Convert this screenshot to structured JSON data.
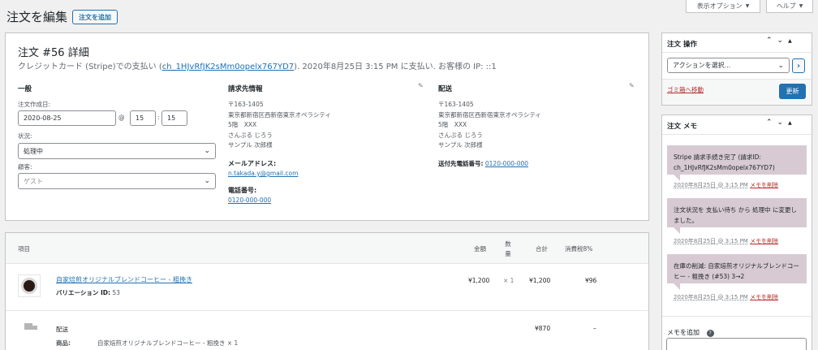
{
  "page": {
    "title": "注文を編集",
    "add_order_button": "注文を追加",
    "screen_options_label": "表示オプション",
    "help_label": "ヘルプ"
  },
  "order": {
    "heading": "注文 #56 詳細",
    "payment_prefix": "クレジットカード (Stripe)での支払い (",
    "payment_link": "ch_1HJvRfJK2sMm0opelx767YD7",
    "payment_suffix": "). 2020年8月25日 3:15 PM に支払い. お客様の IP: ::1"
  },
  "general": {
    "heading": "一般",
    "date_label": "注文作成日:",
    "date_value": "2020-08-25",
    "at_symbol": "@",
    "hour_value": "15",
    "colon": ":",
    "minute_value": "15",
    "status_label": "状況:",
    "status_value": "処理中",
    "customer_label": "顧客:",
    "customer_value": "ゲスト"
  },
  "billing": {
    "heading": "請求先情報",
    "address": "〒163-1405\n東京都新宿区西新宿東京オペラシティ\n5階　XXX\nさんぷる じろう\nサンプル 次郎様",
    "email_label": "メールアドレス:",
    "email_value": "n.takada.y@gmail.com",
    "phone_label": "電話番号:",
    "phone_value": "0120-000-000"
  },
  "shipping": {
    "heading": "配送",
    "address": "〒163-1405\n東京都新宿区西新宿東京オペラシティ\n5階　XXX\nさんぷる じろう\nサンプル 次郎様",
    "phone_label": "送付先電話番号:",
    "phone_value": "0120-000-000"
  },
  "items": {
    "columns": {
      "item": "項目",
      "price": "金額",
      "qty": "数量",
      "total": "合計",
      "tax": "消費税8%"
    },
    "rows": [
      {
        "name": "自家焙煎オリジナルブレンドコーヒー - 粗挽き",
        "variation_label": "バリエーション ID:",
        "variation_id": "53",
        "price": "¥1,200",
        "qty": "× 1",
        "total": "¥1,200",
        "tax": "¥96"
      }
    ],
    "shipping": {
      "label": "配送",
      "products_label": "商品:",
      "products_value": "自家焙煎オリジナルブレンドコーヒー - 粗挽き × 1",
      "total": "¥870",
      "tax": "–"
    }
  },
  "order_actions": {
    "title": "注文 操作",
    "select_placeholder": "アクションを選択...",
    "go_button": "›",
    "trash_link": "ゴミ箱へ移動",
    "update_button": "更新"
  },
  "order_notes": {
    "title": "注文 メモ",
    "notes": [
      {
        "text": "Stripe 請求手続き完了 (請求ID: ch_1HJvRfJK2sMm0opelx767YD7)",
        "meta": "2020年8月25日 @ 3:15 PM",
        "delete": "メモを削除"
      },
      {
        "text": "注文状況を 支払い待ち から 処理中 に変更しました。",
        "meta": "2020年8月25日 @ 3:15 PM",
        "delete": "メモを削除"
      },
      {
        "text": "在庫の削減: 自家焙煎オリジナルブレンドコーヒー - 粗挽き (#53) 3→2",
        "meta": "2020年8月25日 @ 3:15 PM",
        "delete": "メモを削除"
      }
    ],
    "add_note_label": "メモを追加"
  },
  "colors": {
    "accent": "#2271b1",
    "note_bg": "#d7cad2",
    "primary_button": "#2271b1",
    "trash": "#b32d2e"
  }
}
